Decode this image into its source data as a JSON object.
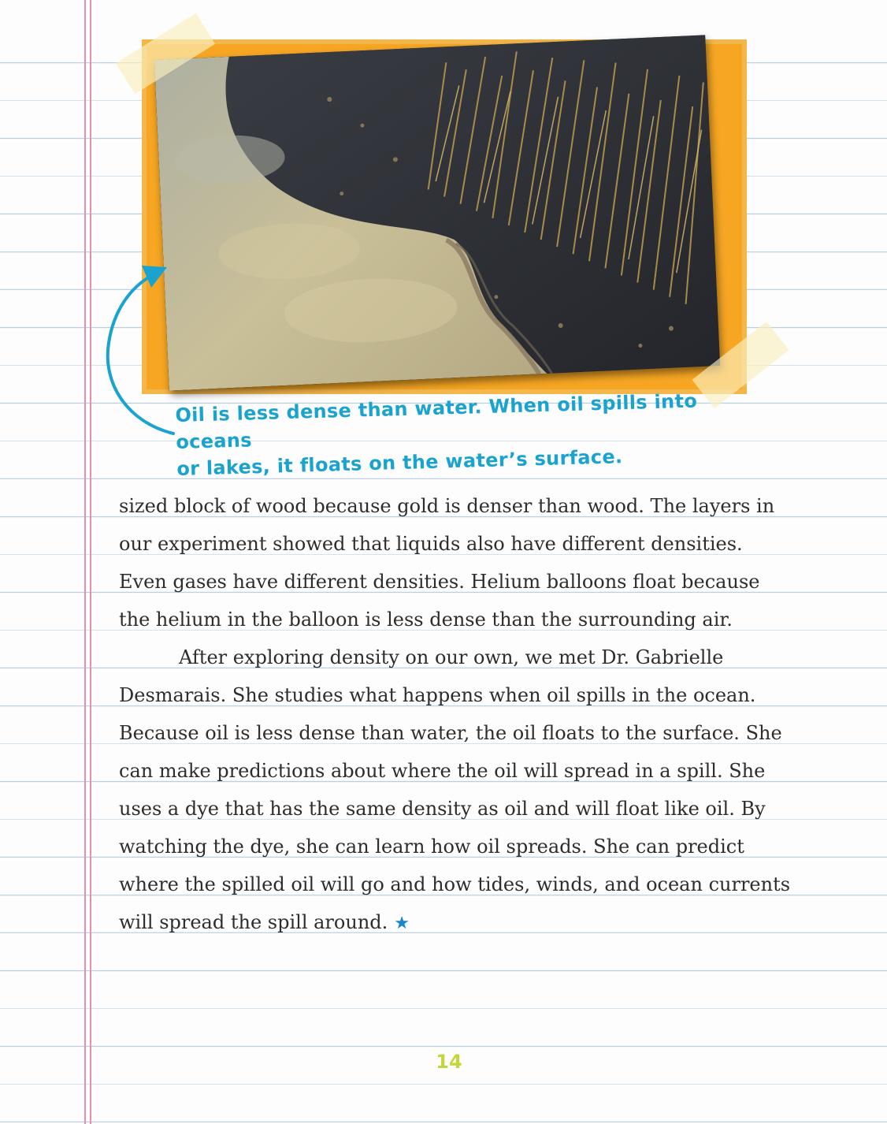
{
  "photo": {
    "subject": "oil-spill-icon"
  },
  "caption": {
    "line1": "Oil is less dense than water. When oil spills into oceans",
    "line2": "or lakes, it floats on the water’s surface."
  },
  "body": {
    "paragraph1": "sized block of wood because gold is denser than wood. The layers in our experiment showed that liquids also have different densities. Even gases have different densities. Helium balloons float because the helium in the balloon is less dense than the surrounding air.",
    "paragraph2": "After exploring density on our own, we met Dr. Gabrielle Desmarais. She studies what happens when oil spills in the ocean. Because oil is less dense than water, the oil floats to the surface. She can make predictions about where the oil will spread in a spill. She uses a dye that has the same density as oil and will float like oil. By watching the dye, she can learn how oil spreads. She can predict where the spilled oil will go and how tides, winds, and ocean currents will spread the spill around.",
    "end_mark": "★"
  },
  "page_number": "14",
  "colors": {
    "frame": "#f6a623",
    "caption": "#1aa3cf",
    "page_number": "#c5d63a",
    "margin_line": "#e48fae",
    "rule_line": "#b9cfe2"
  }
}
